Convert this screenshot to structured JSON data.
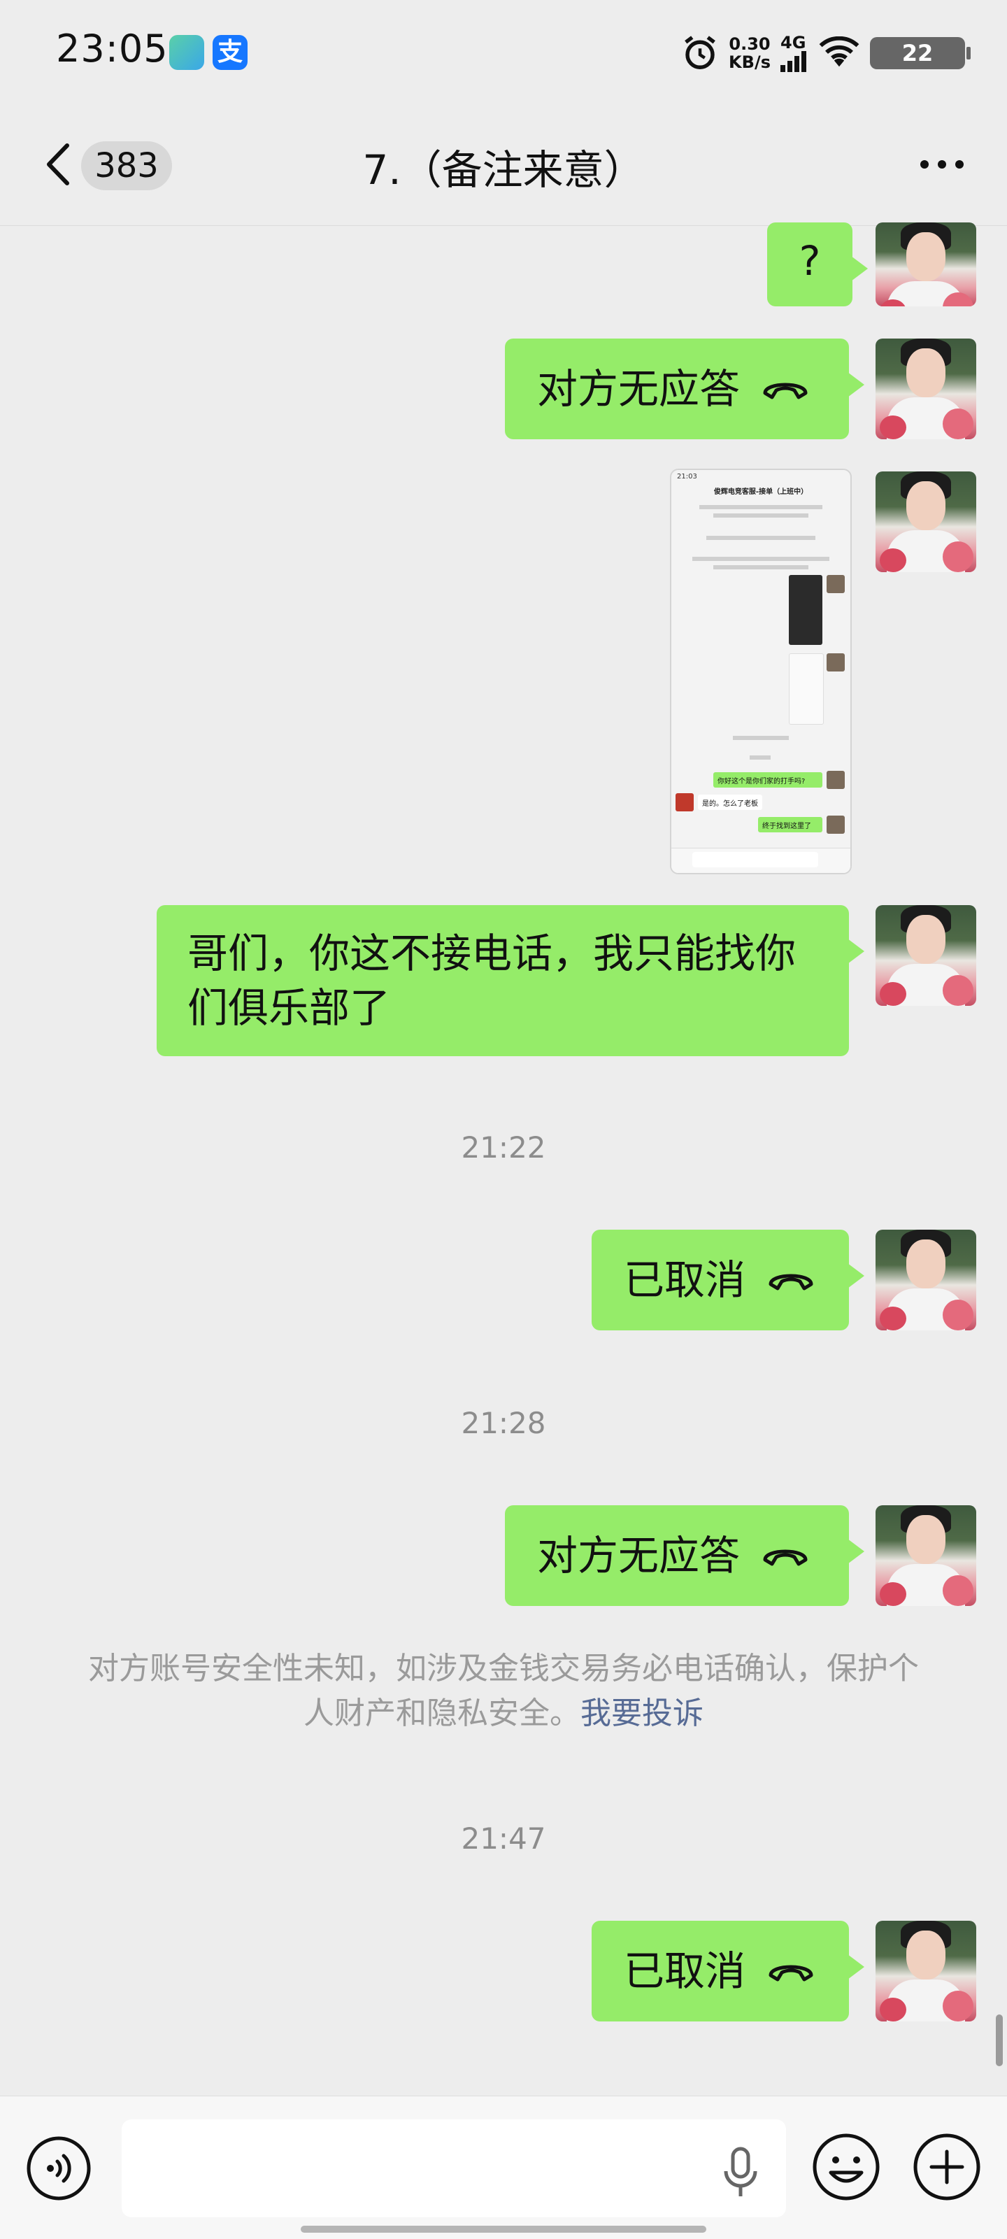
{
  "status_bar": {
    "time": "23:05",
    "alipay_icon": "支",
    "net_speed_value": "0.30",
    "net_speed_unit": "KB/s",
    "signal_label": "4G",
    "battery": "22"
  },
  "header": {
    "back_badge": "383",
    "title": "7.（备注来意）"
  },
  "messages": [
    {
      "kind": "text",
      "text": "?"
    },
    {
      "kind": "call",
      "text": "对方无应答"
    },
    {
      "kind": "image"
    },
    {
      "kind": "text",
      "text": "哥们，你这不接电话，我只能找你们俱乐部了"
    },
    {
      "kind": "time",
      "text": "21:22"
    },
    {
      "kind": "call",
      "text": "已取消"
    },
    {
      "kind": "time",
      "text": "21:28"
    },
    {
      "kind": "call",
      "text": "对方无应答"
    },
    {
      "kind": "system",
      "text": "对方账号安全性未知，如涉及金钱交易务必电话确认，保护个人财产和隐私安全。",
      "link": "我要投诉"
    },
    {
      "kind": "time",
      "text": "21:47"
    },
    {
      "kind": "call",
      "text": "已取消"
    }
  ],
  "thumbnail": {
    "time": "21:03",
    "title": "俊辉电竞客服-接单（上班中）",
    "bubble_1": "你好这个是你们家的打手吗?",
    "reply_1": "是的。怎么了老板",
    "bubble_2": "终于找到这里了"
  },
  "input": {
    "placeholder": ""
  },
  "colors": {
    "background": "#ededed",
    "bubble_self": "#95ec69",
    "link": "#576b95"
  },
  "icons": [
    "back-chevron-icon",
    "more-icon",
    "hangup-icon",
    "voice-icon",
    "mic-icon",
    "emoji-icon",
    "plus-icon"
  ]
}
